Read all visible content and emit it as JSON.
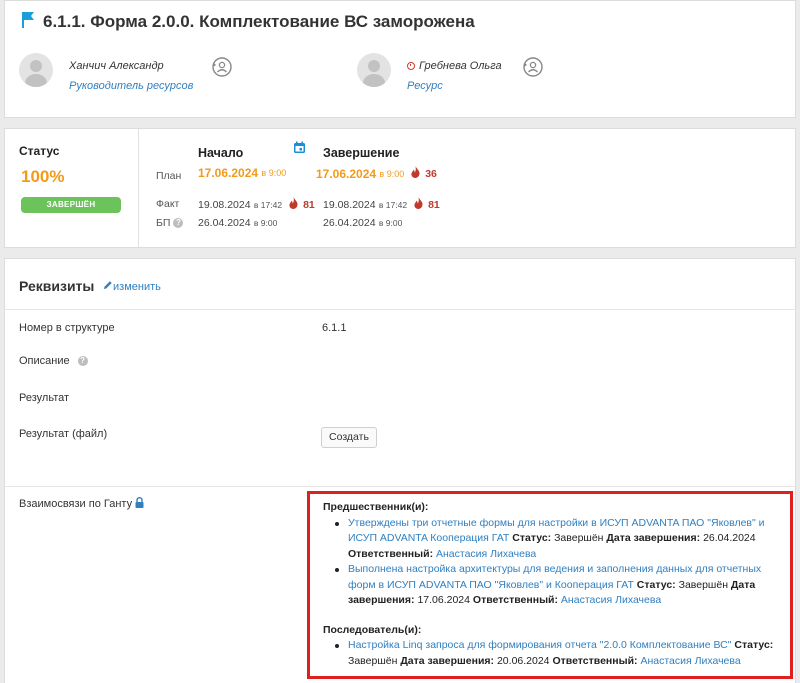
{
  "header": {
    "title": "6.1.1. Форма 2.0.0. Комплектование ВС заморожена",
    "manager": {
      "name": "Ханчич Александр",
      "role": "Руководитель ресурсов"
    },
    "resource": {
      "name": "Гребнева Ольга",
      "role": "Ресурс"
    }
  },
  "status": {
    "label": "Статус",
    "percent": "100%",
    "badge": "ЗАВЕРШЁН",
    "start_header": "Начало",
    "end_header": "Завершение",
    "rows": {
      "plan": {
        "label": "План",
        "start_date": "17.06.2024",
        "start_time": "в 9:00",
        "end_date": "17.06.2024",
        "end_time": "в 9:00",
        "end_late": "36"
      },
      "fact": {
        "label": "Факт",
        "start_date": "19.08.2024",
        "start_time": "в 17:42",
        "start_late": "81",
        "end_date": "19.08.2024",
        "end_time": "в 17:42",
        "end_late": "81"
      },
      "baseline": {
        "label": "БП",
        "start_date": "26.04.2024",
        "start_time": "в 9:00",
        "end_date": "26.04.2024",
        "end_time": "в 9:00"
      }
    }
  },
  "details": {
    "title": "Реквизиты",
    "edit_label": "изменить",
    "fields": {
      "number_label": "Номер в структуре",
      "number_value": "6.1.1",
      "description_label": "Описание",
      "result_label": "Результат",
      "result_file_label": "Результат (файл)",
      "create_button": "Создать",
      "gantt_label": "Взаимосвязи по Ганту"
    },
    "gantt": {
      "predecessors_header": "Предшественник(и):",
      "predecessors": [
        {
          "link": "Утверждены три отчетные формы для настройки в ИСУП ADVANTA ПАО \"Яковлев\" и ИСУП ADVANTA Кооперация ГАТ",
          "status_label": "Статус:",
          "status": "Завершён",
          "date_label": "Дата завершения:",
          "date": "26.04.2024",
          "owner_label": "Ответственный:",
          "owner": "Анастасия Лихачева"
        },
        {
          "link": "Выполнена настройка архитектуры для ведения и заполнения данных для отчетных форм в ИСУП ADVANTA ПАО \"Яковлев\" и Кооперация ГАТ",
          "status_label": "Статус:",
          "status": "Завершён",
          "date_label": "Дата завершения:",
          "date": "17.06.2024",
          "owner_label": "Ответственный:",
          "owner": "Анастасия Лихачева"
        }
      ],
      "successors_header": "Последователь(и):",
      "successors": [
        {
          "link": "Настройка Linq запроса для формирования отчета \"2.0.0 Комплектование ВС\"",
          "status_label": "Статус:",
          "status": "Завершён",
          "date_label": "Дата завершения:",
          "date": "20.06.2024",
          "owner_label": "Ответственный:",
          "owner": "Анастасия Лихачева"
        }
      ]
    }
  },
  "colors": {
    "accent": "#2f7fc1",
    "orange": "#f39a1a",
    "green": "#6cc35b",
    "red": "#e0201f"
  },
  "icons": [
    "flag-icon",
    "swap-user-icon",
    "calendar-icon",
    "fire-icon",
    "help-icon",
    "pencil-icon",
    "lock-icon",
    "avatar-placeholder"
  ]
}
